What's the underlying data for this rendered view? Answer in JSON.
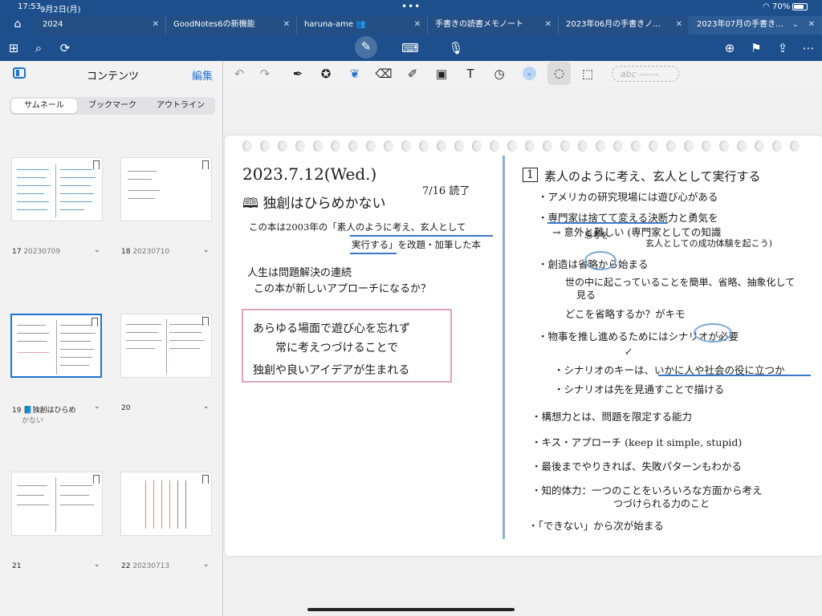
{
  "status": {
    "time": "17:53",
    "date": "9月2日(月)",
    "battery": "70%"
  },
  "tabs": [
    {
      "label": "2024"
    },
    {
      "label": "GoodNotes6の新機能"
    },
    {
      "label": "haruna-ame"
    },
    {
      "label": "手書きの読書メモノート"
    },
    {
      "label": "2023年06月の手書きノ…"
    },
    {
      "label": "2023年07月の手書き…"
    }
  ],
  "sidebar": {
    "title": "コンテンツ",
    "edit": "編集",
    "segments": [
      "サムネール",
      "ブックマーク",
      "アウトライン"
    ],
    "pages": [
      {
        "num": "17",
        "label": "20230709"
      },
      {
        "num": "18",
        "label": "20230710"
      },
      {
        "num": "19",
        "label": "📘独創はひらめ",
        "label2": "かない"
      },
      {
        "num": "20",
        "label": ""
      },
      {
        "num": "21",
        "label": ""
      },
      {
        "num": "22",
        "label": "20230713"
      }
    ]
  },
  "page_tools": {
    "abc": "abc ------"
  },
  "note": {
    "date": "2023.7.12(Wed.)",
    "read": "7/16 読了",
    "book_title": "独創はひらめかない",
    "l1a": "この本は2003年の「",
    "l1b": "素人のように考え、玄人として",
    "l2a": "実行する",
    "l2b": "」を改題・加筆した本",
    "l3": "人生は問題解決の連続",
    "l4": "この本が新しいアプローチになるか？",
    "box1": "あらゆる場面で遊び心を忘れず",
    "box2": "常に考えつづけることで",
    "box3": "独創や良いアイデアが生まれる",
    "r_head_num": "1",
    "r_head": "素人のように考え、玄人として実行する",
    "r1": "・アメリカの研究現場には遊び心がある",
    "r2": "・専門家は捨てて変える決断力と勇気を",
    "r3": "→ 意外と難しい (専門家としての知識",
    "r3b": "思考を",
    "r3c": "玄人としての成功体験を起こう)",
    "r4": "・創造は省略から始まる",
    "r5": "世の中に起こっていることを簡単、省略、抽象化して",
    "r5b": "見る",
    "r6": "どこを省略するか？がキモ",
    "r7": "・物事を推し進めるためにはシナリオが必要",
    "r8": "・シナリオのキーは、いかに人や社会の役に立つか",
    "r9": "・シナリオは先を見通すことで描ける",
    "r10": "・構想力とは、問題を限定する能力",
    "r11": "・キス・アプローチ (keep it simple, stupid)",
    "r12": "・最後までやりきれば、失敗パターンもわかる",
    "r13": "・知的体力：一つのことをいろいろな方面から考え",
    "r13b": "つづけられる力のこと",
    "r14": "・「できない」から次が始まる"
  }
}
